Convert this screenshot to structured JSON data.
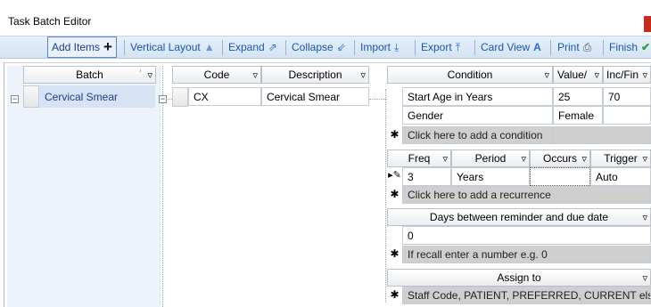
{
  "window": {
    "title": "Task Batch Editor"
  },
  "toolbar": {
    "add_items": "Add Items",
    "vertical_layout": "Vertical Layout",
    "expand": "Expand",
    "collapse": "Collapse",
    "import": "Import",
    "export": "Export",
    "card_view": "Card View",
    "print": "Print",
    "finish": "Finish"
  },
  "batch": {
    "header": "Batch",
    "rows": [
      "Cervical Smear"
    ]
  },
  "code_grid": {
    "code_header": "Code",
    "desc_header": "Description",
    "rows": [
      {
        "code": "CX",
        "description": "Cervical Smear"
      }
    ]
  },
  "conditions": {
    "headers": {
      "condition": "Condition",
      "value": "Value/",
      "incfin": "Inc/Fin"
    },
    "rows": [
      {
        "condition": "Start Age in Years",
        "value": "25",
        "incfin": "70"
      },
      {
        "condition": "Gender",
        "value": "Female",
        "incfin": ""
      }
    ],
    "new_row": "Click here to add a condition"
  },
  "recurrence": {
    "headers": {
      "freq": "Freq",
      "period": "Period",
      "occurs": "Occurs",
      "trigger": "Trigger"
    },
    "row": {
      "freq": "3",
      "period": "Years",
      "occurs": "",
      "trigger": "Auto"
    },
    "new_row": "Click here to add a recurrence"
  },
  "reminder": {
    "header": "Days between reminder and due date",
    "value": "0",
    "hint": "If recall enter a number e.g. 0"
  },
  "assign": {
    "header": "Assign to",
    "hint": "Staff Code, PATIENT, PREFERRED, CURRENT els..."
  },
  "colors": {
    "toolbar_text": "#1a56b0",
    "batch_text": "#1f3c8a",
    "new_row_bg": "#cfcfcf",
    "close": "#c42b1c",
    "finish_check": "#2e9b3a"
  }
}
